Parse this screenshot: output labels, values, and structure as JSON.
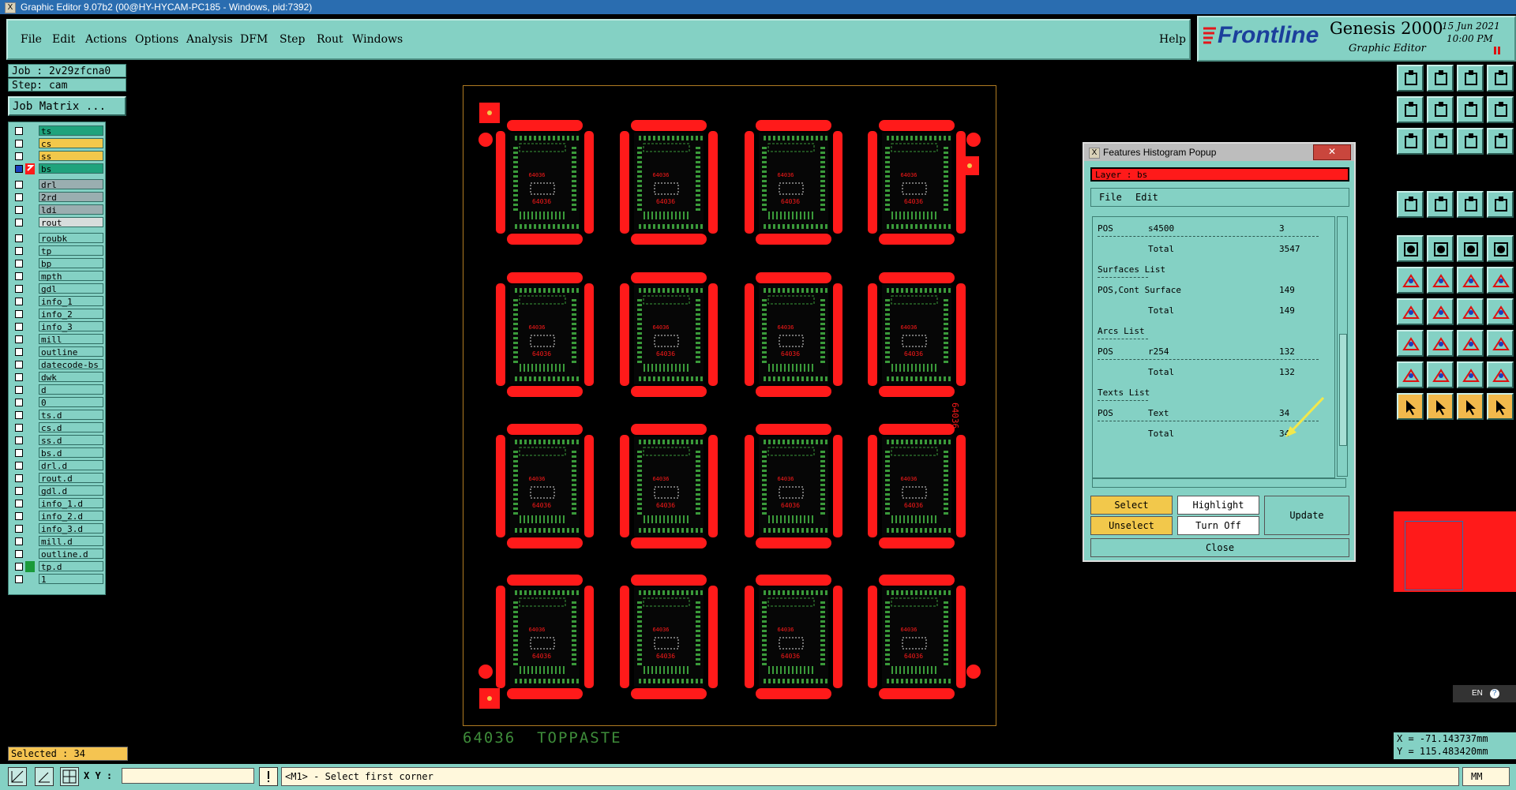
{
  "window": {
    "title": "Graphic Editor 9.07b2 (00@HY-HYCAM-PC185 - Windows, pid:7392)"
  },
  "menu": [
    "File",
    "Edit",
    "Actions",
    "Options",
    "Analysis",
    "DFM",
    "Step",
    "Rout",
    "Windows"
  ],
  "help": "Help",
  "brand": {
    "logo": "Frontline",
    "product": "Genesis 2000",
    "subtitle": "Graphic Editor",
    "date": "15 Jun 2021",
    "time": "10:00 PM"
  },
  "job": {
    "label": "Job : 2v29zfcna0",
    "step": "Step: cam",
    "matrix_btn": "Job Matrix ..."
  },
  "layers": [
    {
      "name": "ts",
      "color": "#1fa37c"
    },
    {
      "name": "cs",
      "color": "#f2c84b"
    },
    {
      "name": "ss",
      "color": "#f2c84b"
    },
    {
      "name": "bs",
      "color": "#1fa37c",
      "active": true
    },
    {
      "name": "drl",
      "color": "#9aaeb0"
    },
    {
      "name": "2rd",
      "color": "#9aaeb0"
    },
    {
      "name": "ldi",
      "color": "#9aaeb0"
    },
    {
      "name": "rout",
      "color": "#d7dddc"
    },
    {
      "name": "roubk"
    },
    {
      "name": "tp"
    },
    {
      "name": "bp"
    },
    {
      "name": "mpth"
    },
    {
      "name": "gdl"
    },
    {
      "name": "info_1"
    },
    {
      "name": "info_2"
    },
    {
      "name": "info_3"
    },
    {
      "name": "mill"
    },
    {
      "name": "outline"
    },
    {
      "name": "datecode-bs"
    },
    {
      "name": "dwk"
    },
    {
      "name": "d"
    },
    {
      "name": "0"
    },
    {
      "name": "ts.d"
    },
    {
      "name": "cs.d"
    },
    {
      "name": "ss.d"
    },
    {
      "name": "bs.d"
    },
    {
      "name": "drl.d"
    },
    {
      "name": "rout.d"
    },
    {
      "name": "gdl.d"
    },
    {
      "name": "info_1.d"
    },
    {
      "name": "info_2.d"
    },
    {
      "name": "info_3.d"
    },
    {
      "name": "mill.d"
    },
    {
      "name": "outline.d"
    },
    {
      "name": "tp.d",
      "marked": true
    },
    {
      "name": "1"
    }
  ],
  "selected": "Selected : 34",
  "canvas": {
    "caption": "64036  TOPPASTE",
    "tile_text": "64036",
    "side_text": "64036"
  },
  "popup": {
    "title": "Features Histogram Popup",
    "layer": "Layer :  bs",
    "menu": [
      "File",
      "Edit"
    ],
    "rows": [
      {
        "c1": "POS",
        "c2": "s4500",
        "c3": "3"
      },
      {
        "c1": "",
        "c2": "Total",
        "c3": "3547"
      },
      {
        "c1": "Surfaces List",
        "c2": "",
        "c3": ""
      },
      {
        "c1": "POS,Cont Surface",
        "c2": "",
        "c3": "149"
      },
      {
        "c1": "",
        "c2": "Total",
        "c3": "149"
      },
      {
        "c1": "Arcs List",
        "c2": "",
        "c3": ""
      },
      {
        "c1": "POS",
        "c2": "r254",
        "c3": "132"
      },
      {
        "c1": "",
        "c2": "Total",
        "c3": "132"
      },
      {
        "c1": "Texts List",
        "c2": "",
        "c3": ""
      },
      {
        "c1": "POS",
        "c2": "Text",
        "c3": "34"
      },
      {
        "c1": "",
        "c2": "Total",
        "c3": "34"
      }
    ],
    "buttons": {
      "select": "Select",
      "highlight": "Highlight",
      "update": "Update",
      "unselect": "Unselect",
      "turnoff": "Turn Off",
      "close": "Close"
    }
  },
  "status": {
    "xy_label": "X Y :",
    "xy_value": "",
    "prompt": "<M1> - Select first corner",
    "units": "MM"
  },
  "coords": {
    "x": "X = -71.143737mm",
    "y": "Y = 115.483420mm"
  },
  "lang": "EN",
  "colors": {
    "teal": "#84d1c4",
    "red": "#ff1a1a",
    "green": "#1a9a3a",
    "orange": "#b07b22",
    "yellow": "#f2c84b"
  }
}
